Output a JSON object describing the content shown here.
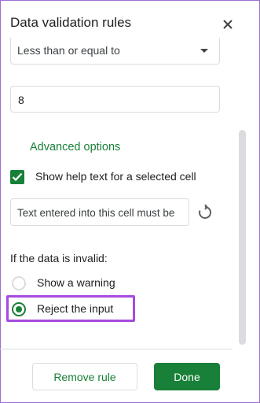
{
  "panel": {
    "title": "Data validation rules",
    "close_icon": "close-icon"
  },
  "criteria": {
    "condition_value": "Less than or equal to",
    "input_value": "8"
  },
  "advanced": {
    "label": "Advanced options",
    "help_checkbox_label": "Show help text for a selected cell",
    "help_checkbox_checked": true,
    "help_text_value": "Text entered into this cell must be",
    "reset_icon": "reset-icon"
  },
  "invalid": {
    "label": "If the data is invalid:",
    "options": [
      {
        "label": "Show a warning",
        "selected": false
      },
      {
        "label": "Reject the input",
        "selected": true
      }
    ]
  },
  "footer": {
    "remove_label": "Remove rule",
    "done_label": "Done"
  },
  "colors": {
    "accent": "#188038",
    "highlight": "#a64be0"
  }
}
